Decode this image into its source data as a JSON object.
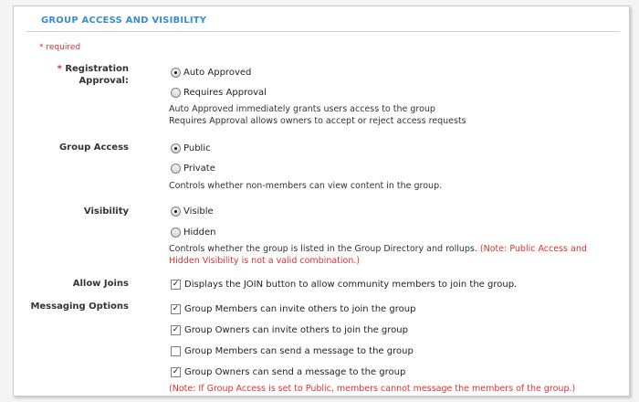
{
  "section": {
    "title": "GROUP ACCESS AND VISIBILITY",
    "required_note": "* required"
  },
  "registration": {
    "asterisk": "*",
    "label_line1": "Registration",
    "label_line2": "Approval:",
    "options": [
      "Auto Approved",
      "Requires Approval"
    ],
    "selected": "Auto Approved",
    "help_line1": "Auto Approved immediately grants users access to the group",
    "help_line2": "Requires Approval allows owners to accept or reject access requests"
  },
  "group_access": {
    "label": "Group Access",
    "options": [
      "Public",
      "Private"
    ],
    "selected": "Public",
    "help": "Controls whether non-members can view content in the group."
  },
  "visibility": {
    "label": "Visibility",
    "options": [
      "Visible",
      "Hidden"
    ],
    "selected": "Visible",
    "help": "Controls whether the group is listed in the Group Directory and rollups.",
    "note_line1": "(Note: Public Access and",
    "note_line2": "Hidden Visibility is not a valid combination.)"
  },
  "allow_joins": {
    "label": "Allow Joins",
    "checked": true,
    "text": "Displays the JOIN button to allow community members to join the group."
  },
  "messaging": {
    "label": "Messaging Options",
    "options": [
      {
        "text": "Group Members can invite others to join the group",
        "checked": true
      },
      {
        "text": "Group Owners can invite others to join the group",
        "checked": true
      },
      {
        "text": "Group Members can send a message to the group",
        "checked": false
      },
      {
        "text": "Group Owners can send a message to the group",
        "checked": true
      }
    ],
    "note": "(Note: If Group Access is set to Public, members cannot message the members of the group.)"
  }
}
